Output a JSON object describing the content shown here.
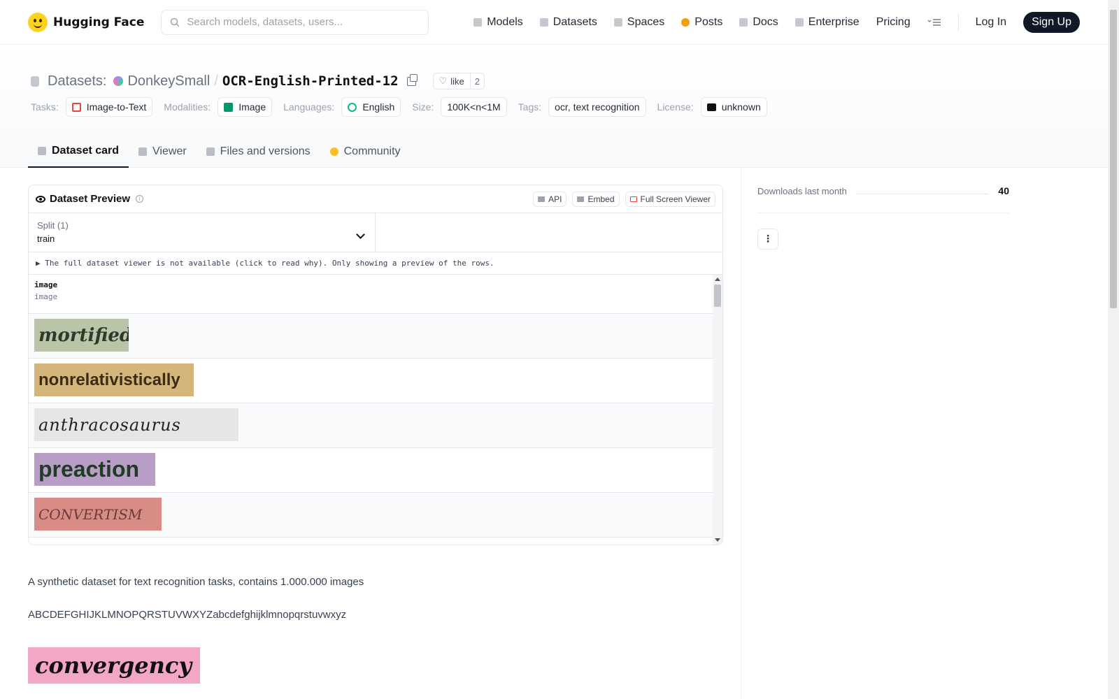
{
  "nav": {
    "brand": "Hugging Face",
    "search_placeholder": "Search models, datasets, users...",
    "links": [
      "Models",
      "Datasets",
      "Spaces",
      "Posts",
      "Docs",
      "Enterprise",
      "Pricing"
    ],
    "login": "Log In",
    "signup": "Sign Up"
  },
  "header": {
    "section_label": "Datasets:",
    "org": "DonkeySmall",
    "slash": "/",
    "dataset_name": "OCR-English-Printed-12",
    "like_label": "like",
    "like_count": "2",
    "tags": {
      "tasks_label": "Tasks:",
      "tasks": "Image-to-Text",
      "modalities_label": "Modalities:",
      "modalities": "Image",
      "languages_label": "Languages:",
      "languages": "English",
      "size_label": "Size:",
      "size": "100K<n<1M",
      "tags_label": "Tags:",
      "tags": "ocr, text recognition",
      "license_label": "License:",
      "license": "unknown"
    },
    "tabs": [
      "Dataset card",
      "Viewer",
      "Files and versions",
      "Community"
    ]
  },
  "preview": {
    "title": "Dataset Preview",
    "api": "API",
    "embed": "Embed",
    "fullscreen": "Full Screen Viewer",
    "split_label": "Split (1)",
    "split_value": "train",
    "notice": "▶ The full dataset viewer is not available (click to read why). Only showing a preview of the rows.",
    "column_name": "image",
    "column_type": "image",
    "rows": [
      {
        "text": "mortified",
        "bg": "#b9c4a8",
        "color": "#2f3a2a"
      },
      {
        "text": "nonrelativistically",
        "bg": "#d4b67a",
        "color": "#3b2a14"
      },
      {
        "text": "anthracosaurus",
        "bg": "#e5e7e4",
        "color": "#222"
      },
      {
        "text": "preaction",
        "bg": "#b89ec7",
        "color": "#1f3d24"
      },
      {
        "text": "CONVERTISM",
        "bg": "#d98c86",
        "color": "#6b3a3a"
      }
    ]
  },
  "card": {
    "description": "A synthetic dataset for text recognition tasks, contains 1.000.000 images",
    "alphabet": "ABCDEFGHIJKLMNOPQRSTUVWXYZabcdefghijklmnopqrstuvwxyz",
    "sample_word": "convergency"
  },
  "sidebar": {
    "downloads_label": "Downloads last month",
    "downloads_value": "40",
    "menu_label": "⋮"
  }
}
